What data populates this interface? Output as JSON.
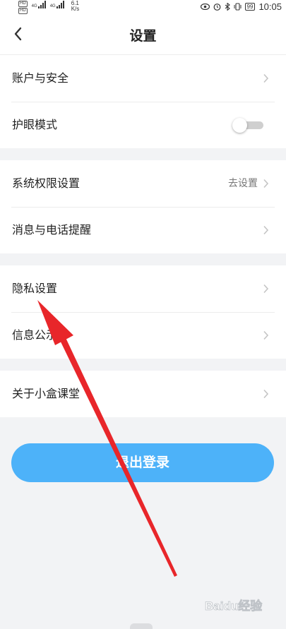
{
  "status_bar": {
    "net_tags": [
      "HD",
      "4G",
      "HD",
      "4G"
    ],
    "speed_value": "6.1",
    "speed_unit": "K/s",
    "battery": "99",
    "time": "10:05"
  },
  "header": {
    "title": "设置",
    "back_icon": "chevron-left-icon"
  },
  "groups": [
    {
      "items": [
        {
          "label": "账户与安全",
          "control": "chevron"
        },
        {
          "label": "护眼模式",
          "control": "toggle",
          "toggle_on": false
        }
      ]
    },
    {
      "items": [
        {
          "label": "系统权限设置",
          "control": "chevron",
          "value": "去设置"
        },
        {
          "label": "消息与电话提醒",
          "control": "chevron"
        }
      ]
    },
    {
      "items": [
        {
          "label": "隐私设置",
          "control": "chevron"
        },
        {
          "label": "信息公示",
          "control": "chevron"
        }
      ]
    },
    {
      "items": [
        {
          "label": "关于小盒课堂",
          "control": "chevron"
        }
      ]
    }
  ],
  "logout_label": "退出登录",
  "watermark_text": "Baidu经验",
  "colors": {
    "accent": "#4db2f9",
    "page_bg": "#f2f3f5",
    "annotation_arrow": "#e8262a"
  }
}
